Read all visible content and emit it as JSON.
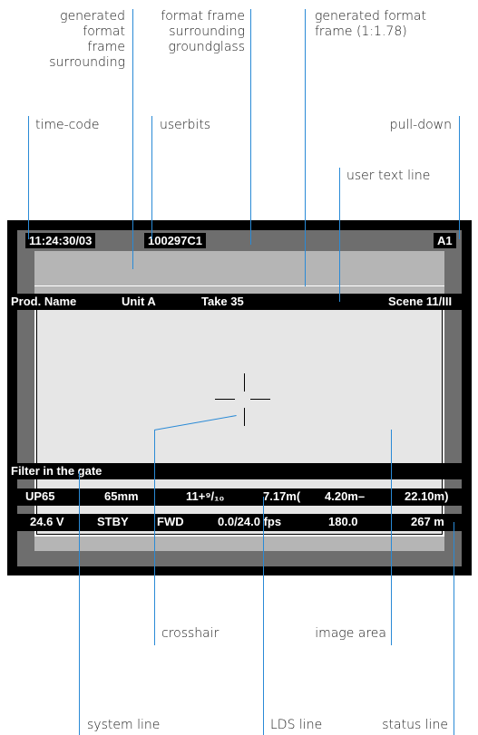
{
  "labels": {
    "generated_frame_surrounding": "generated\nformat\nframe\nsurrounding",
    "format_frame_groundglass": "format frame\nsurrounding\ngroundglass",
    "generated_format_frame": "generated format\nframe (1:1.78)",
    "time_code": "time-code",
    "userbits": "userbits",
    "pull_down": "pull-down",
    "user_text_line": "user text line",
    "crosshair": "crosshair",
    "image_area": "image area",
    "system_line": "system line",
    "lds_line": "LDS line",
    "status_line": "status line"
  },
  "top_bar": {
    "timecode": "11:24:30/03",
    "userbits": "100297C1",
    "pulldown": "A1"
  },
  "user_text": {
    "prod": "Prod. Name",
    "unit": "Unit A",
    "take": "Take 35",
    "scene": "Scene 11/III"
  },
  "system_line": "Filter in the gate",
  "lds_line": {
    "lens": "UP65",
    "focal": "65mm",
    "iris": "11+⁹/₁₀",
    "focus": "7.17m(",
    "near": "4.20m–",
    "far": "22.10m)"
  },
  "status_line": {
    "voltage": "24.6 V",
    "mode": "STBY",
    "direction": "FWD",
    "fps": "0.0/24.0 fps",
    "shutter": "180.0",
    "length": "267 m"
  },
  "colors": {
    "callout_line": "#2a8ad6",
    "outer_frame": "#000000",
    "groundglass": "#6e6e6e",
    "generated_frame": "#b5b5b5",
    "image_area": "#e6e6e6"
  }
}
